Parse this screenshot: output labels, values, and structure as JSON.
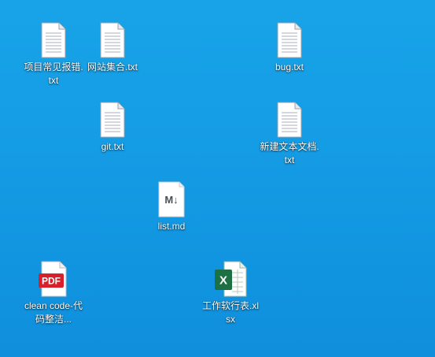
{
  "desktop": {
    "items": [
      {
        "label": "项目常见报错.txt",
        "icon": "text-file-icon"
      },
      {
        "label": "网站集合.txt",
        "icon": "text-file-icon"
      },
      {
        "label": "bug.txt",
        "icon": "text-file-icon"
      },
      {
        "label": "git.txt",
        "icon": "text-file-icon"
      },
      {
        "label": "新建文本文档.txt",
        "icon": "text-file-icon"
      },
      {
        "label": "list.md",
        "icon": "markdown-file-icon",
        "badge": "M↓"
      },
      {
        "label": "clean code-代码整洁...",
        "icon": "pdf-file-icon",
        "badge": "PDF"
      },
      {
        "label": "工作软行表.xlsx",
        "icon": "excel-file-icon",
        "badge": "X"
      }
    ]
  },
  "colors": {
    "desktop_background": "#149be4",
    "pdf_red": "#d9202a",
    "excel_green": "#1d7044"
  }
}
